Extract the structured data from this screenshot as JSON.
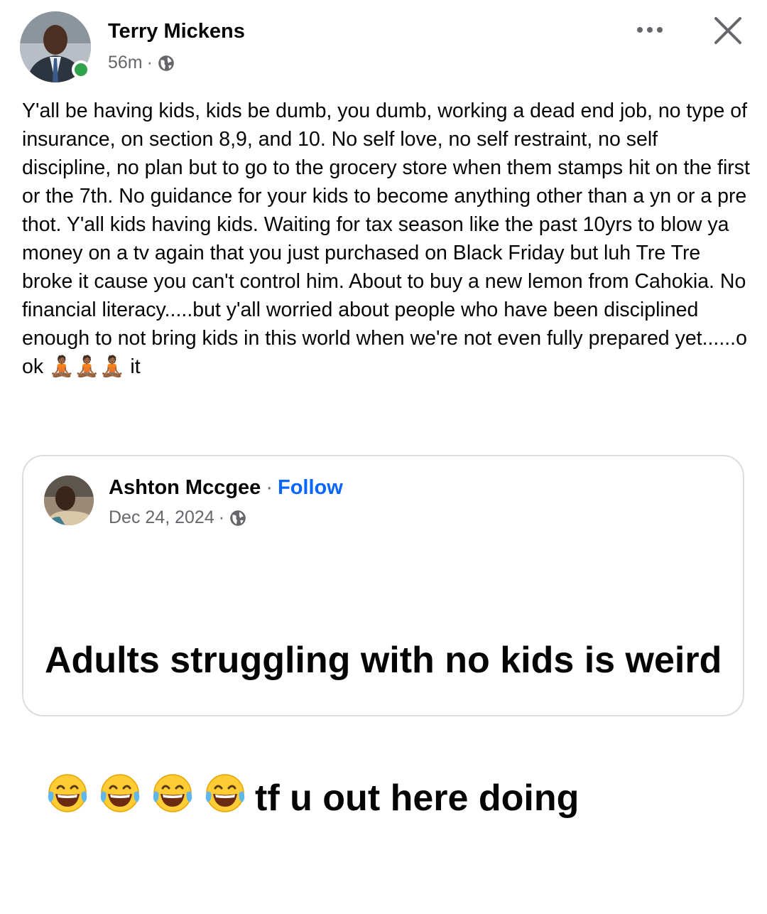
{
  "post": {
    "author": "Terry Mickens",
    "time": "56m",
    "separator": "·",
    "privacy_icon": "globe-icon",
    "more_icon": "more-options-icon",
    "close_icon": "close-icon",
    "text": "Y'all be having kids, kids be dumb, you dumb, working a dead end job, no type of insurance, on section 8,9, and 10. No self love, no self restraint, no self discipline, no plan but to go to the grocery store when them stamps hit on the first or the 7th. No guidance for your kids to become anything other than a yn or a pre thot. Y'all kids having kids. Waiting for tax season like the past 10yrs to blow ya money on a tv again that you just purchased on Black Friday but luh Tre Tre broke it cause you can't control him. About to buy a new lemon from Cahokia. No financial literacy.....but y'all worried about people who have been disciplined enough to not bring kids in this world when we're not even fully prepared yet......o ok 🧘🏾🧘🏾🧘🏾 it"
  },
  "shared_post": {
    "author": "Ashton Mccgee",
    "separator": "·",
    "follow_label": "Follow",
    "date": "Dec 24, 2024",
    "privacy_icon": "globe-icon",
    "text_line1": "Adults struggling with no kids is weird",
    "emoji_icon": "laughing-tears-icon",
    "emoji_count": 4,
    "text_line2": "tf u out here doing"
  },
  "colors": {
    "online": "#31a24c",
    "link": "#0866ff",
    "secondary_text": "#65676b",
    "border": "#dadde1"
  }
}
